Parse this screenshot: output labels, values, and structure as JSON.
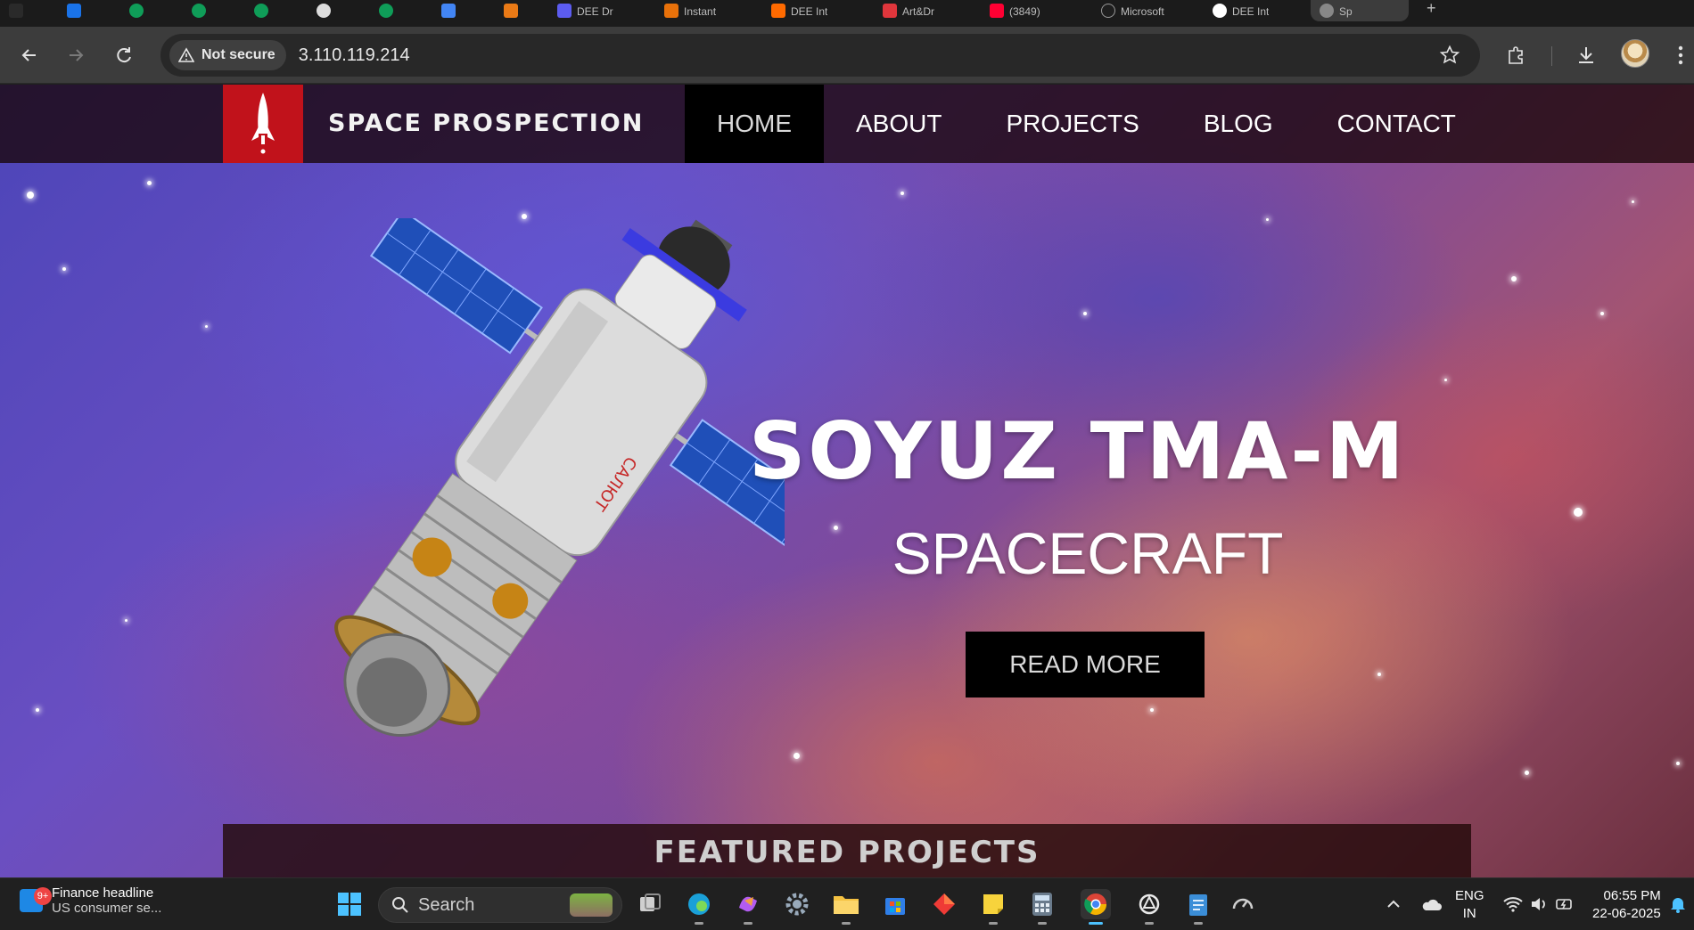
{
  "browser": {
    "tabs": [
      {
        "title": "",
        "color": "#2a2a2a"
      },
      {
        "title": "",
        "color": "#1a73e8"
      },
      {
        "title": "",
        "color": "#0f9d58"
      },
      {
        "title": "",
        "color": "#0f9d58"
      },
      {
        "title": "",
        "color": "#0f9d58"
      },
      {
        "title": "",
        "color": "#dddddd"
      },
      {
        "title": "",
        "color": "#0f9d58"
      },
      {
        "title": "",
        "color": "#4285f4"
      },
      {
        "title": "",
        "color": "#ea7a16"
      },
      {
        "title": "DEE Dr",
        "color": "#5c5cf0"
      },
      {
        "title": "Instant",
        "color": "#e8710a"
      },
      {
        "title": "DEE Int",
        "color": "#ff6a00"
      },
      {
        "title": "Art&Dr",
        "color": "#e0363c"
      },
      {
        "title": "(3849)",
        "color": "#ff0033"
      },
      {
        "title": "Microsoft",
        "color": "#1e1e1e"
      },
      {
        "title": "DEE Int",
        "color": "#ffffff"
      },
      {
        "title": "Sp",
        "color": "#888888"
      }
    ],
    "security_chip": "Not secure",
    "url": "3.110.119.214"
  },
  "site": {
    "brand": "SPACE PROSPECTION",
    "menu": [
      "HOME",
      "ABOUT",
      "PROJECTS",
      "BLOG",
      "CONTACT"
    ],
    "active_menu": "HOME",
    "hero_title": "SOYUZ TMA-M",
    "hero_subtitle": "SPACECRAFT",
    "cta": "READ MORE",
    "featured_heading": "FEATURED PROJECTS",
    "accent_color": "#c1121b"
  },
  "taskbar": {
    "news_title": "Finance headline",
    "news_snippet": "US consumer se...",
    "news_badge": "9+",
    "search_placeholder": "Search",
    "lang_line1": "ENG",
    "lang_line2": "IN",
    "time": "06:55 PM",
    "date": "22-06-2025"
  }
}
